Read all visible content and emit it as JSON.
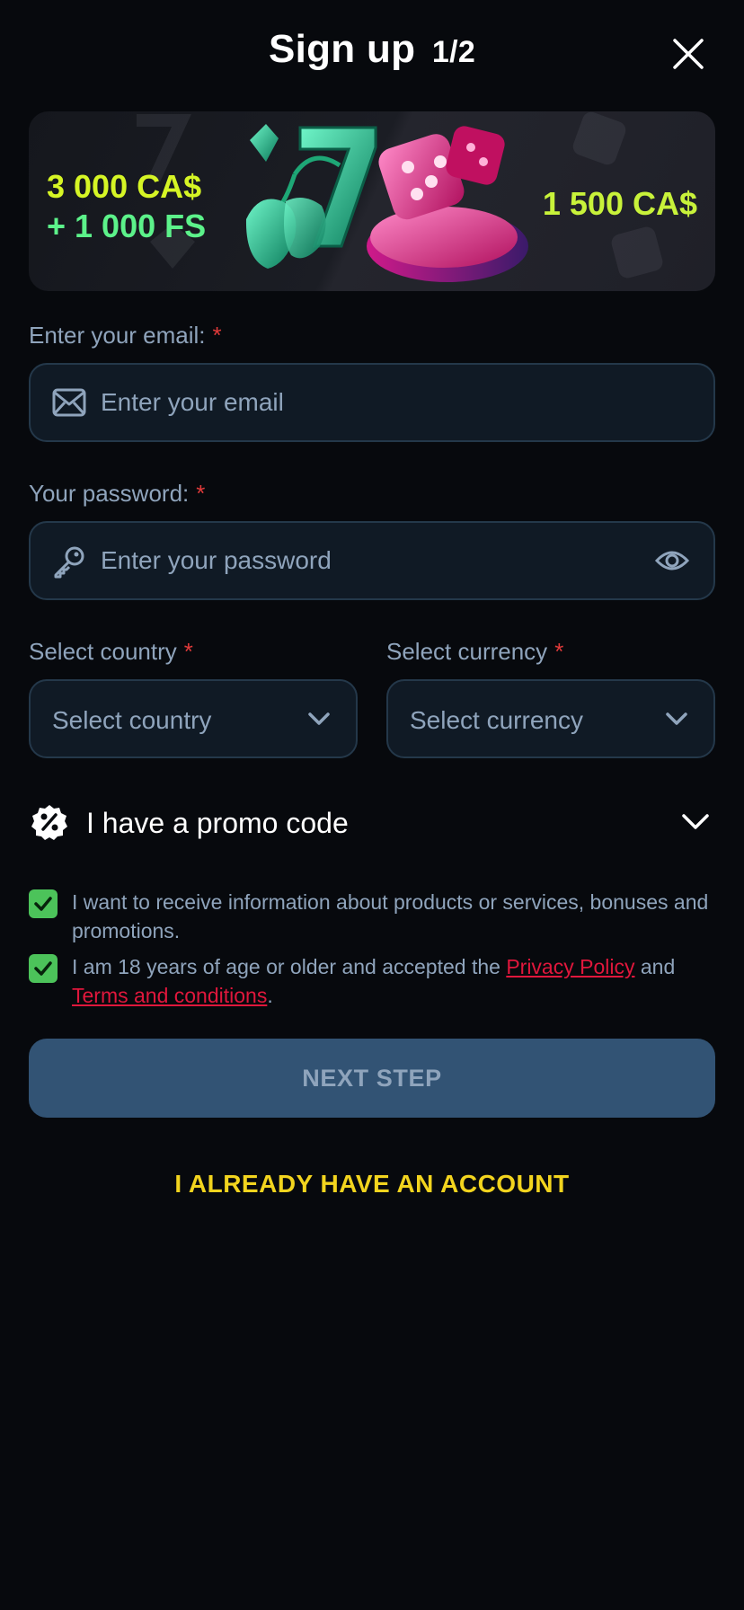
{
  "header": {
    "title": "Sign up",
    "step": "1/2"
  },
  "banner": {
    "left_line1": "3 000 CA$",
    "left_line2": "+ 1 000 FS",
    "right_amount": "1 500 CA$"
  },
  "email": {
    "label": "Enter your email:",
    "required_mark": "*",
    "placeholder": "Enter your email"
  },
  "password": {
    "label": "Your password:",
    "required_mark": "*",
    "placeholder": "Enter your password"
  },
  "country": {
    "label": "Select country",
    "required_mark": "*",
    "selected": "Select country"
  },
  "currency": {
    "label": "Select currency",
    "required_mark": "*",
    "selected": "Select currency"
  },
  "promo": {
    "label": "I have a promo code"
  },
  "consents": {
    "marketing": {
      "checked": true,
      "text": "I want to receive information about products or services, bonuses and promotions."
    },
    "age": {
      "checked": true,
      "text_before": "I am 18 years of age or older and accepted the ",
      "privacy_link": "Privacy Policy",
      "text_middle": " and",
      "terms_link": "Terms and conditions",
      "text_end": "."
    }
  },
  "actions": {
    "next_label": "NEXT STEP",
    "account_label": "I ALREADY HAVE AN ACCOUNT"
  },
  "colors": {
    "background": "#07090d",
    "input_bg": "#101a25",
    "input_border": "#24384a",
    "muted_text": "#8fa4bc",
    "required": "#e03a3a",
    "checkbox": "#4cc35a",
    "link": "#e0173c",
    "button_disabled": "#325374",
    "account_link": "#f2d41e"
  },
  "icons": [
    "close-icon",
    "mail-icon",
    "key-icon",
    "eye-icon",
    "chevron-down-icon",
    "percent-badge-icon",
    "check-icon"
  ]
}
